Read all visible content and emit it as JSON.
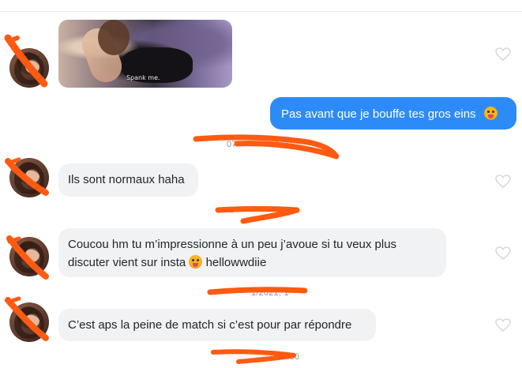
{
  "messages": [
    {
      "side": "incoming",
      "kind": "gif",
      "caption": "Spank me."
    },
    {
      "side": "outgoing",
      "text": "Pas avant que je bouffe tes gros  eins",
      "emoji": "tongue-emoji"
    },
    {
      "side": "incoming",
      "text": "Ils sont normaux haha"
    },
    {
      "side": "incoming",
      "line1": "Coucou hm tu m’impressionne à un peu j’avoue si tu veux plus",
      "line2_before": "discuter vient sur insta",
      "line2_after": "hellowwdiie",
      "emoji": "tongue-emoji"
    },
    {
      "side": "incoming",
      "text": "C’est aps la peine de match si c’est pour par répondre"
    }
  ],
  "timestamps": [
    {
      "visible": "07",
      "visible_end": "0:30"
    },
    {
      "visible": "1"
    },
    {
      "visible": "1/2021, 1"
    },
    {
      "visible": "0:30"
    }
  ],
  "colors": {
    "outgoing_bubble": "#2d8bf7",
    "incoming_bubble": "#f0f2f4",
    "redaction": "#ff5a12"
  }
}
